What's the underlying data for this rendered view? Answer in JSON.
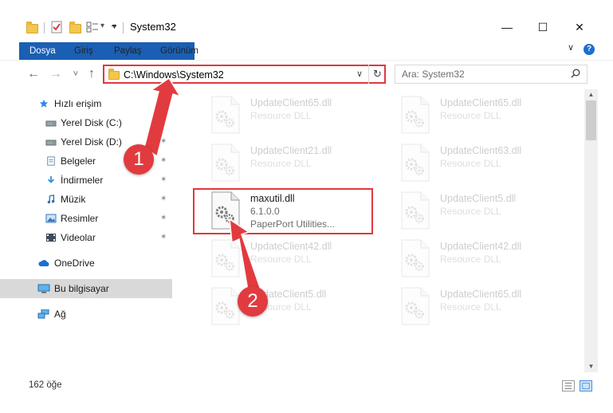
{
  "window": {
    "title": "System32",
    "minimize_glyph": "—",
    "maximize_glyph": "☐",
    "close_glyph": "✕"
  },
  "quick_access_toolbar": {
    "icons": [
      "folder-icon",
      "properties-icon",
      "new-folder-icon",
      "customize-icon"
    ],
    "dropdown_glyph": "▾"
  },
  "ribbon": {
    "tabs": [
      {
        "label": "Dosya",
        "active": true
      },
      {
        "label": "Giriş",
        "active": false
      },
      {
        "label": "Paylaş",
        "active": false
      },
      {
        "label": "Görünüm",
        "active": false
      }
    ],
    "expand_glyph": "∨",
    "help_glyph": "?"
  },
  "navigation": {
    "back_glyph": "←",
    "forward_glyph": "→",
    "recent_glyph": "˅",
    "up_glyph": "↑",
    "address": "C:\\Windows\\System32",
    "address_dropdown_glyph": "∨",
    "refresh_glyph": "↻",
    "search_placeholder": "Ara: System32"
  },
  "sidebar": {
    "items": [
      {
        "label": "Hızlı erişim",
        "icon": "star-icon",
        "pinned": false
      },
      {
        "label": "Yerel Disk (C:)",
        "icon": "drive-icon",
        "pinned": true
      },
      {
        "label": "Yerel Disk (D:)",
        "icon": "drive-icon",
        "pinned": true
      },
      {
        "label": "Belgeler",
        "icon": "documents-icon",
        "pinned": true
      },
      {
        "label": "İndirmeler",
        "icon": "download-icon",
        "pinned": true
      },
      {
        "label": "Müzik",
        "icon": "music-icon",
        "pinned": true
      },
      {
        "label": "Resimler",
        "icon": "pictures-icon",
        "pinned": true
      },
      {
        "label": "Videolar",
        "icon": "video-icon",
        "pinned": true
      },
      {
        "label": "OneDrive",
        "icon": "cloud-icon",
        "pinned": false
      },
      {
        "label": "Bu bilgisayar",
        "icon": "computer-icon",
        "pinned": false,
        "selected": true
      },
      {
        "label": "Ağ",
        "icon": "network-icon",
        "pinned": false
      }
    ],
    "pin_glyph": "✶"
  },
  "files": [
    {
      "name": "UpdateClient65.dll",
      "type": "Resource DLL",
      "faded": true
    },
    {
      "name": "UpdateClient65.dll",
      "type": "Resource DLL",
      "faded": true
    },
    {
      "name": "UpdateClient21.dll",
      "type": "Resource DLL",
      "faded": true
    },
    {
      "name": "UpdateClient63.dll",
      "type": "Resource DLL",
      "faded": true
    },
    {
      "name": "maxutil.dll",
      "version": "6.1.0.0",
      "type": "PaperPort Utilities...",
      "faded": false,
      "selected": true
    },
    {
      "name": "UpdateClient5.dll",
      "type": "Resource DLL",
      "faded": true
    },
    {
      "name": "UpdateClient42.dll",
      "type": "Resource DLL",
      "faded": true
    },
    {
      "name": "UpdateClient42.dll",
      "type": "Resource DLL",
      "faded": true
    },
    {
      "name": "UpdateClient5.dll",
      "type": "Resource DLL",
      "faded": true
    },
    {
      "name": "UpdateClient65.dll",
      "type": "Resource DLL",
      "faded": true
    }
  ],
  "callouts": [
    {
      "number": "1"
    },
    {
      "number": "2"
    }
  ],
  "status_bar": {
    "item_count": "162 öğe",
    "views": [
      "details-view-icon",
      "large-icons-view-icon"
    ]
  },
  "colors": {
    "accent": "#1a5fb4",
    "highlight_red": "#e0383e",
    "selected_nav": "#d9d9d9"
  }
}
